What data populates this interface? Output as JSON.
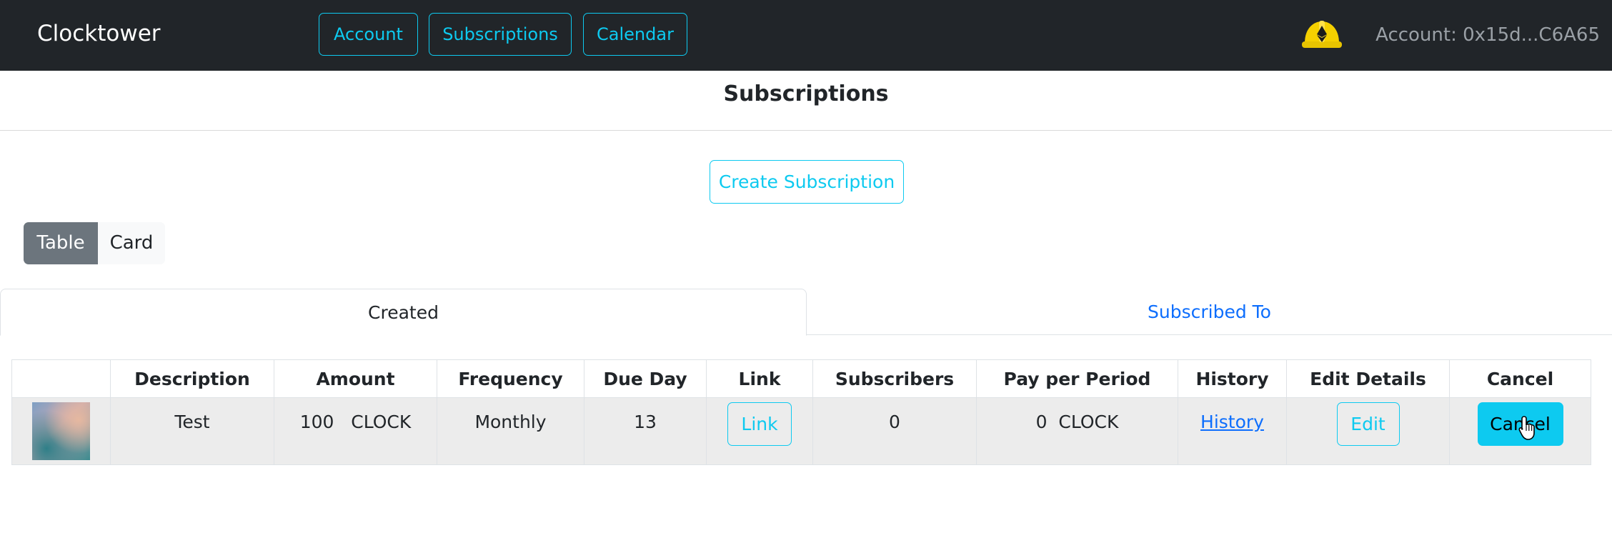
{
  "navbar": {
    "brand": "Clocktower",
    "links": [
      "Account",
      "Subscriptions",
      "Calendar"
    ],
    "helmet_icon": "ethereum-helmet-icon",
    "account_label": "Account: 0x15d...C6A65"
  },
  "page": {
    "title": "Subscriptions",
    "create_button": "Create Subscription"
  },
  "view_toggle": {
    "options": [
      "Table",
      "Card"
    ],
    "selected": "Table"
  },
  "tabs": {
    "items": [
      "Created",
      "Subscribed To"
    ],
    "active": "Created"
  },
  "table": {
    "columns": [
      "",
      "Description",
      "Amount",
      "Frequency",
      "Due Day",
      "Link",
      "Subscribers",
      "Pay per Period",
      "History",
      "Edit Details",
      "Cancel"
    ],
    "rows": [
      {
        "description": "Test",
        "amount": "100   CLOCK",
        "frequency": "Monthly",
        "due_day": "13",
        "link_label": "Link",
        "subscribers": "0",
        "pay_per_period": "0  CLOCK",
        "history_label": "History",
        "edit_label": "Edit",
        "cancel_label": "Cancel"
      }
    ]
  },
  "colors": {
    "navbar_bg": "#212529",
    "accent_info": "#0dcaf0",
    "link_blue": "#0d6efd",
    "toggle_selected": "#6c757d",
    "row_bg": "#ececec"
  }
}
